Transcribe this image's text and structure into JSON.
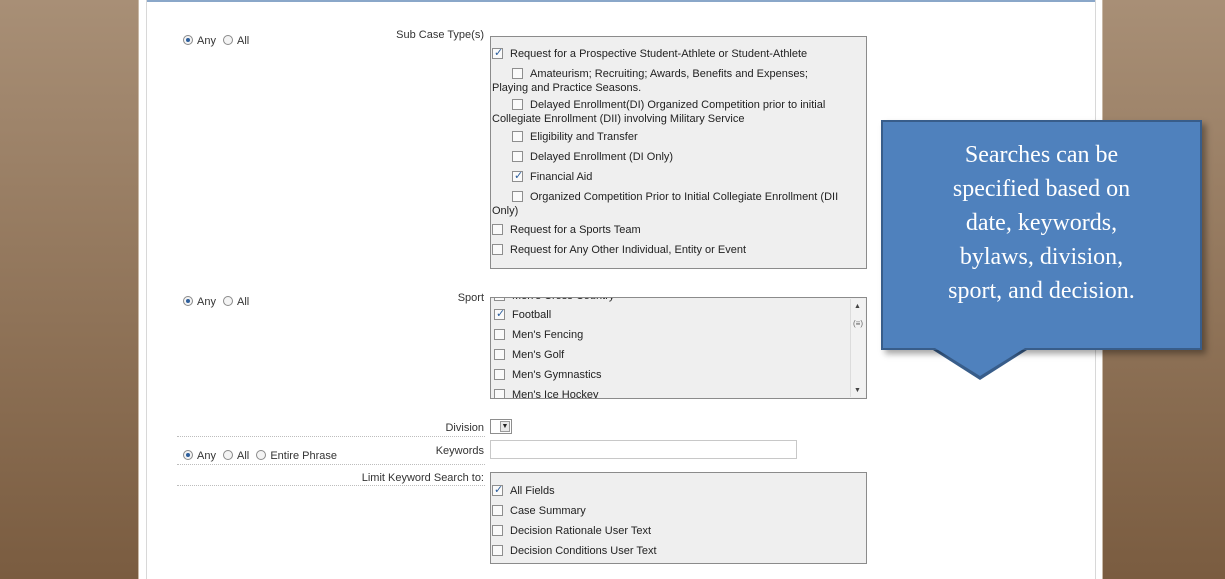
{
  "radio_labels": {
    "any": "Any",
    "all": "All",
    "entire_phrase": "Entire Phrase"
  },
  "sub_case": {
    "label": "Sub Case Type(s)",
    "match": "Any",
    "items": [
      {
        "label": "Request for a Prospective Student-Athlete or Student-Athlete",
        "checked": true,
        "level": 0
      },
      {
        "label": "Amateurism; Recruiting; Awards, Benefits and Expenses;",
        "label2": "Playing and Practice Seasons.",
        "checked": false,
        "level": 1
      },
      {
        "label": "Delayed Enrollment(DI) Organized Competition prior to initial",
        "label2": "Collegiate Enrollment (DII) involving Military Service",
        "checked": false,
        "level": 1
      },
      {
        "label": "Eligibility and Transfer",
        "checked": false,
        "level": 1
      },
      {
        "label": "Delayed Enrollment (DI Only)",
        "checked": false,
        "level": 1
      },
      {
        "label": "Financial Aid",
        "checked": true,
        "level": 1
      },
      {
        "label": "Organized Competition Prior to Initial Collegiate Enrollment (DII",
        "label2": "Only)",
        "checked": false,
        "level": 1
      },
      {
        "label": "Request for a Sports Team",
        "checked": false,
        "level": 0
      },
      {
        "label": "Request for Any Other Individual, Entity or Event",
        "checked": false,
        "level": 0
      }
    ]
  },
  "sport": {
    "label": "Sport",
    "match": "Any",
    "items": [
      {
        "label": "Men's Cross Country",
        "checked": false
      },
      {
        "label": "Football",
        "checked": true
      },
      {
        "label": "Men's Fencing",
        "checked": false
      },
      {
        "label": "Men's Golf",
        "checked": false
      },
      {
        "label": "Men's Gymnastics",
        "checked": false
      },
      {
        "label": "Men's Ice Hockey",
        "checked": false
      }
    ]
  },
  "division": {
    "label": "Division",
    "value": ""
  },
  "keywords": {
    "label": "Keywords",
    "match": "Any",
    "value": ""
  },
  "limit": {
    "label": "Limit Keyword Search to:",
    "items": [
      {
        "label": "All Fields",
        "checked": true
      },
      {
        "label": "Case Summary",
        "checked": false
      },
      {
        "label": "Decision Rationale User Text",
        "checked": false
      },
      {
        "label": "Decision Conditions User Text",
        "checked": false
      }
    ]
  },
  "callout": {
    "lines": [
      "Searches can be",
      "specified based on",
      "date, keywords,",
      "bylaws, division,",
      "sport, and decision."
    ]
  },
  "colors": {
    "callout_fill": "#4f81bd",
    "callout_border": "#385d8a",
    "side_panel": "#8f7358",
    "check_accent": "#2e5f9c"
  }
}
